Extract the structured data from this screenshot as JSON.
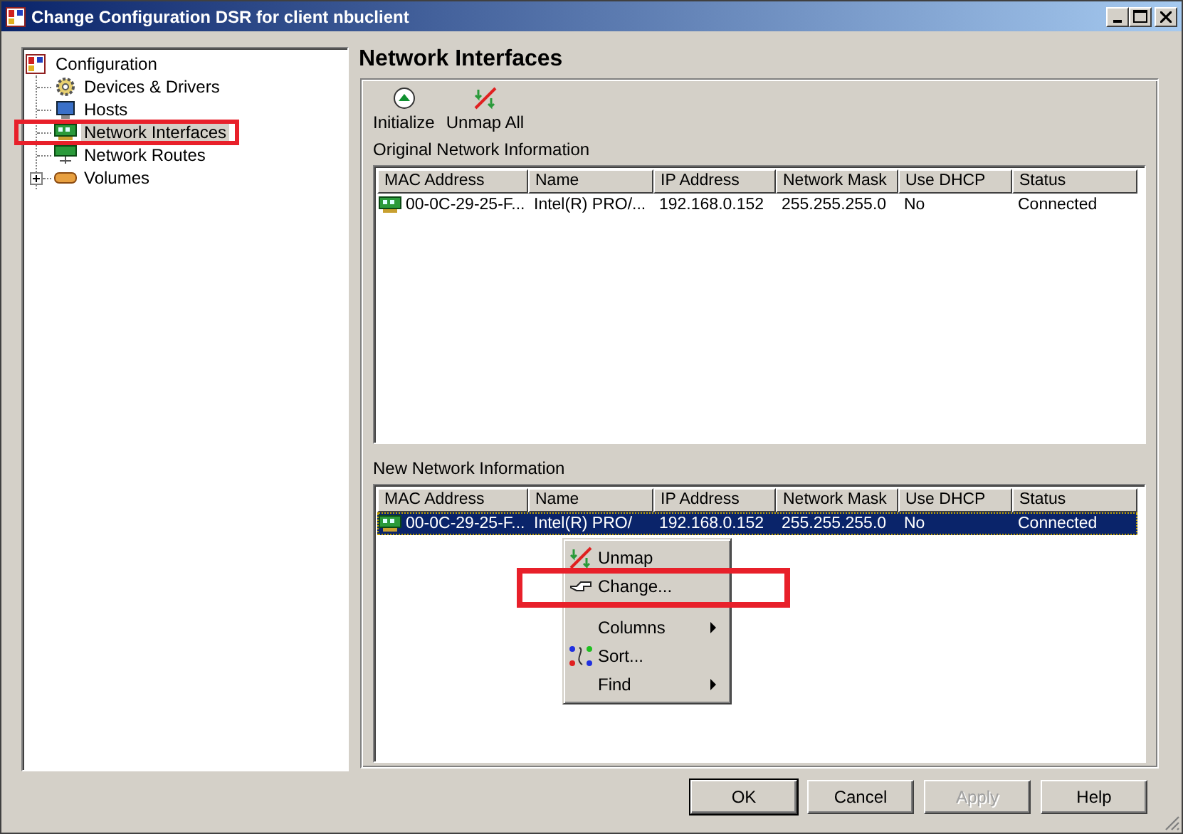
{
  "window": {
    "title": "Change Configuration DSR for client nbuclient"
  },
  "tree": {
    "label": "Configuration",
    "children": [
      {
        "label": "Devices & Drivers",
        "kind": "leaf",
        "selected": false,
        "highlighted": false
      },
      {
        "label": "Hosts",
        "kind": "leaf",
        "selected": false,
        "highlighted": false
      },
      {
        "label": "Network Interfaces",
        "kind": "leaf",
        "selected": true,
        "highlighted": true
      },
      {
        "label": "Network Routes",
        "kind": "leaf",
        "selected": false,
        "highlighted": false
      },
      {
        "label": "Volumes",
        "kind": "collapsed",
        "selected": false,
        "highlighted": false
      }
    ]
  },
  "page_title": "Network Interfaces",
  "toolbar": [
    {
      "label": "Initialize"
    },
    {
      "label": "Unmap All"
    }
  ],
  "tables": [
    {
      "title": "Original Network Information",
      "columns": [
        "MAC Address",
        "Name",
        "IP Address",
        "Network Mask",
        "Use DHCP",
        "Status"
      ],
      "rows": [
        {
          "cells": [
            "00-0C-29-25-F...",
            "Intel(R) PRO/...",
            "192.168.0.152",
            "255.255.255.0",
            "No",
            "Connected"
          ],
          "selected": false
        }
      ]
    },
    {
      "title": "New Network Information",
      "columns": [
        "MAC Address",
        "Name",
        "IP Address",
        "Network Mask",
        "Use DHCP",
        "Status"
      ],
      "rows": [
        {
          "cells": [
            "00-0C-29-25-F...",
            "Intel(R) PRO/",
            "192.168.0.152",
            "255.255.255.0",
            "No",
            "Connected"
          ],
          "selected": true
        }
      ]
    }
  ],
  "context_menu": [
    {
      "kind": "item",
      "label": "Unmap",
      "submenu": false,
      "highlighted": false
    },
    {
      "kind": "item",
      "label": "Change...",
      "submenu": false,
      "highlighted": true
    },
    {
      "kind": "separator"
    },
    {
      "kind": "item",
      "label": "Columns",
      "submenu": true,
      "highlighted": false
    },
    {
      "kind": "item",
      "label": "Sort...",
      "submenu": false,
      "highlighted": false
    },
    {
      "kind": "item",
      "label": "Find",
      "submenu": true,
      "highlighted": false
    }
  ],
  "buttons": [
    {
      "label": "OK",
      "default": true,
      "disabled": false
    },
    {
      "label": "Cancel",
      "default": false,
      "disabled": false
    },
    {
      "label": "Apply",
      "default": false,
      "disabled": true
    },
    {
      "label": "Help",
      "default": false,
      "disabled": false
    }
  ]
}
